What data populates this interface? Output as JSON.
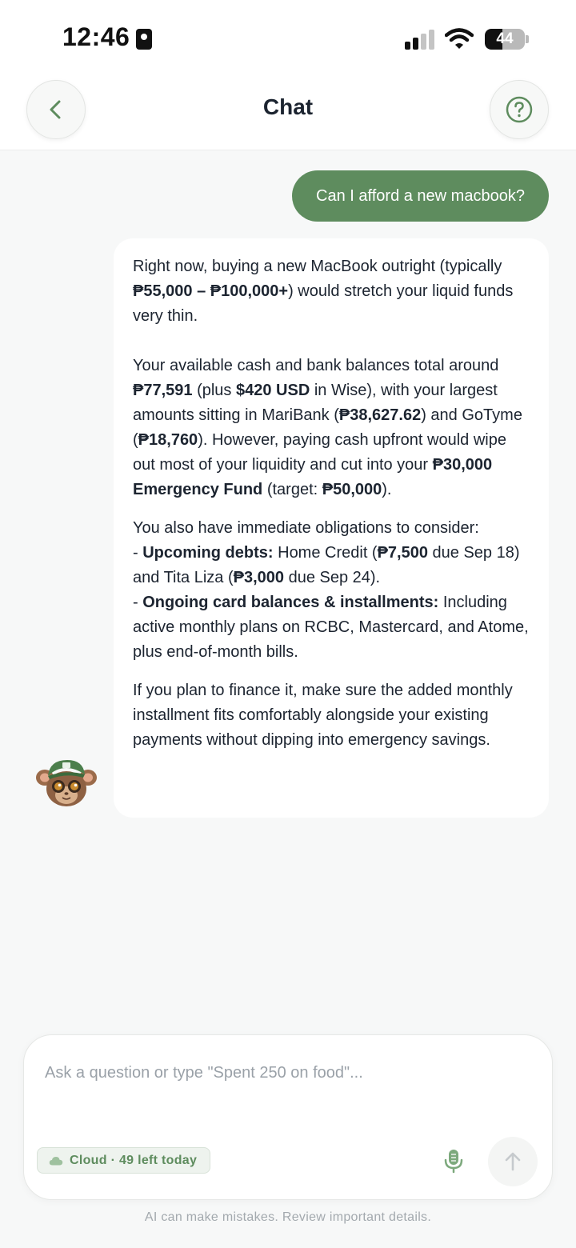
{
  "status_bar": {
    "time": "12:46",
    "battery": "44",
    "battery_level_percent": 44,
    "icons": [
      "contact-card-icon",
      "signal-icon",
      "wifi-icon",
      "battery-icon"
    ]
  },
  "header": {
    "title": "Chat",
    "back_icon": "chevron-left-icon",
    "help_icon": "question-circle-icon"
  },
  "messages": {
    "user": "Can I afford a new macbook?",
    "assistant": {
      "p1": {
        "a": "Right now, buying a new MacBook outright (typically ",
        "b": "₱55,000 – ₱100,000+",
        "c": ") would stretch your liquid funds very thin."
      },
      "p2": {
        "a": "Your available cash and bank balances total around ",
        "b": "₱77,591",
        "c": " (plus ",
        "d": "$420 USD",
        "e": " in Wise), with your largest amounts sitting in MariBank (",
        "f": "₱38,627.62",
        "g": ") and GoTyme (",
        "h": "₱18,760",
        "i": "). However, paying cash upfront would wipe out most of your liquidity and cut into your ",
        "j": "₱30,000 Emergency Fund",
        "k": " (target: ",
        "l": "₱50,000",
        "m": ")."
      },
      "p3": {
        "a": "You also have immediate obligations to consider:",
        "b": "- ",
        "c": "Upcoming debts:",
        "d": " Home Credit (",
        "e": "₱7,500",
        "f": " due Sep 18) and Tita Liza (",
        "g": "₱3,000",
        "h": " due Sep 24).",
        "i": "- ",
        "j": "Ongoing card balances & installments:",
        "k": " Including active monthly plans on RCBC, Mastercard, and Atome, plus end-of-month bills."
      },
      "p4": "If you plan to finance it, make sure the added monthly installment fits comfortably alongside your existing payments without dipping into emergency savings."
    }
  },
  "composer": {
    "placeholder": "Ask a question or type \"Spent 250 on food\"...",
    "value": "",
    "cloud_badge": "Cloud · 49 left today",
    "mic_icon": "microphone-icon",
    "send_icon": "arrow-up-icon"
  },
  "disclaimer": "AI can make mistakes. Review important details.",
  "colors": {
    "accent": "#5e8c5e",
    "background": "#f7f8f8",
    "text": "#1c2430",
    "muted": "#9aa1a8"
  }
}
